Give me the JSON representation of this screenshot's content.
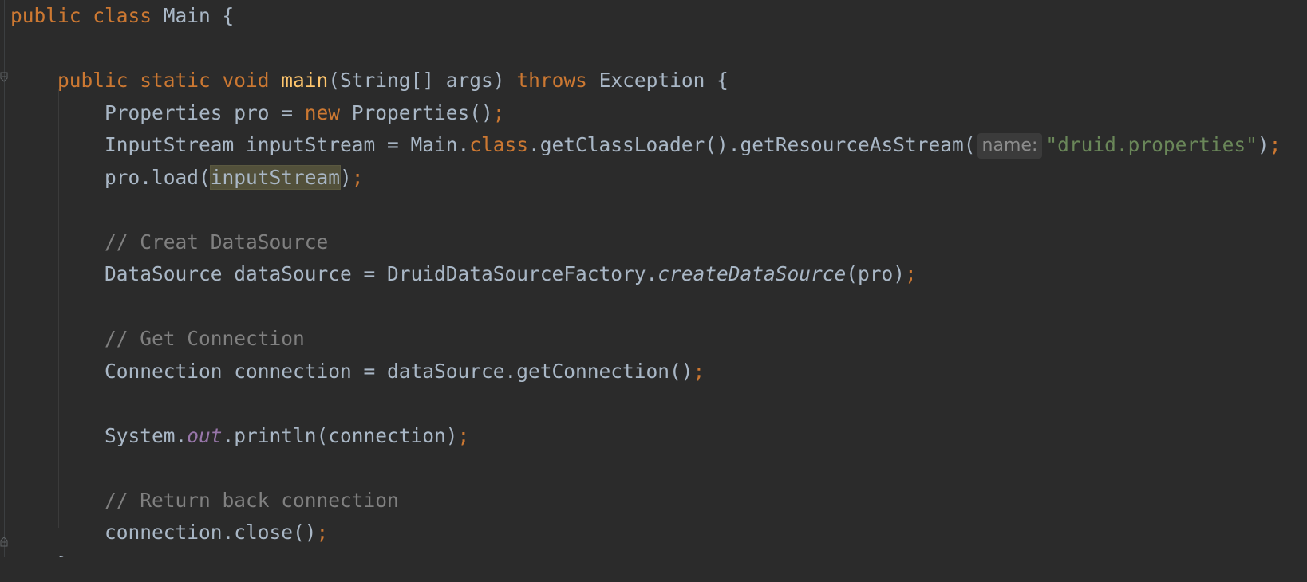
{
  "editor": {
    "language": "Java",
    "lines": [
      [
        {
          "t": "kw",
          "v": "public class "
        },
        {
          "t": "plain",
          "v": "Main {"
        }
      ],
      [],
      [
        {
          "t": "plain",
          "v": "    "
        },
        {
          "t": "kw",
          "v": "public static void "
        },
        {
          "t": "fn",
          "v": "main"
        },
        {
          "t": "plain",
          "v": "(String[] args) "
        },
        {
          "t": "kw",
          "v": "throws "
        },
        {
          "t": "plain",
          "v": "Exception {"
        }
      ],
      [
        {
          "t": "plain",
          "v": "        Properties pro = "
        },
        {
          "t": "kw",
          "v": "new "
        },
        {
          "t": "plain",
          "v": "Properties()"
        },
        {
          "t": "semi",
          "v": ";"
        }
      ],
      [
        {
          "t": "plain",
          "v": "        InputStream inputStream = Main."
        },
        {
          "t": "kw",
          "v": "class"
        },
        {
          "t": "plain",
          "v": ".getClassLoader().getResourceAsStream("
        },
        {
          "t": "hint",
          "v": "name:"
        },
        {
          "t": "str",
          "v": "\"druid.properties\""
        },
        {
          "t": "plain",
          "v": ")"
        },
        {
          "t": "semi",
          "v": ";"
        }
      ],
      [
        {
          "t": "plain",
          "v": "        pro.load("
        },
        {
          "t": "highlight",
          "v": "inputStream"
        },
        {
          "t": "plain",
          "v": ")"
        },
        {
          "t": "semi",
          "v": ";"
        }
      ],
      [],
      [
        {
          "t": "plain",
          "v": "        "
        },
        {
          "t": "cm",
          "v": "// Creat DataSource"
        }
      ],
      [
        {
          "t": "plain",
          "v": "        DataSource dataSource = DruidDataSourceFactory."
        },
        {
          "t": "static-call",
          "v": "createDataSource"
        },
        {
          "t": "plain",
          "v": "(pro)"
        },
        {
          "t": "semi",
          "v": ";"
        }
      ],
      [],
      [
        {
          "t": "plain",
          "v": "        "
        },
        {
          "t": "cm",
          "v": "// Get Connection"
        }
      ],
      [
        {
          "t": "plain",
          "v": "        Connection connection = dataSource.getConnection()"
        },
        {
          "t": "semi",
          "v": ";"
        }
      ],
      [],
      [
        {
          "t": "plain",
          "v": "        System."
        },
        {
          "t": "static-field",
          "v": "out"
        },
        {
          "t": "plain",
          "v": ".println(connection)"
        },
        {
          "t": "semi",
          "v": ";"
        }
      ],
      [],
      [
        {
          "t": "plain",
          "v": "        "
        },
        {
          "t": "cm",
          "v": "// Return back connection"
        }
      ],
      [
        {
          "t": "plain",
          "v": "        connection.close()"
        },
        {
          "t": "semi",
          "v": ";"
        }
      ],
      [
        {
          "t": "plain",
          "v": "    }"
        }
      ]
    ]
  },
  "colors": {
    "background": "#2b2b2b",
    "text": "#a9b7c6",
    "keyword": "#cc7832",
    "method_declaration": "#ffc66d",
    "string": "#6a8759",
    "comment": "#808080",
    "static_field": "#9876aa",
    "usage_highlight": "#52503a"
  }
}
